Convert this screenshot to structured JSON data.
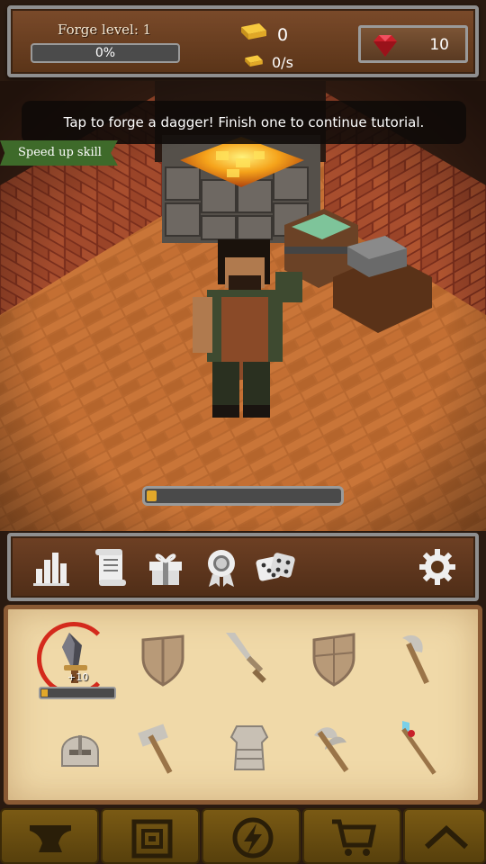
{
  "hud": {
    "forge_level_label": "Forge level: 1",
    "forge_progress": 0,
    "forge_progress_text": "0%",
    "gold_count": "0",
    "gold_rate": "0/s",
    "gem_count": "10"
  },
  "scene": {
    "tutorial_text": "Tap to forge a dagger! Finish one to continue tutorial.",
    "speedup_label": "Speed up skill",
    "forge_item_progress": 0.05
  },
  "toolbar": {
    "buttons": [
      "stats-icon",
      "scroll-icon",
      "gift-icon",
      "award-icon",
      "dice-icon",
      "gear-icon"
    ]
  },
  "inventory": {
    "active_item_level": "+10",
    "active_item_progress": 0.08,
    "items": [
      "dagger",
      "wooden-shield",
      "short-sword",
      "heater-shield",
      "battle-axe",
      "helmet",
      "war-hammer",
      "chest-armor",
      "double-axe",
      "magic-staff"
    ]
  },
  "bottom_nav": {
    "items": [
      "anvil-icon",
      "blueprint-icon",
      "lightning-icon",
      "cart-icon",
      "chevron-up-icon"
    ]
  },
  "colors": {
    "wood_dark": "#5a3418",
    "bar_fill": "#e2a82a",
    "parchment": "#f0d9a8",
    "ring_red": "#d42a1c",
    "nav_gold": "#7a5a14"
  }
}
